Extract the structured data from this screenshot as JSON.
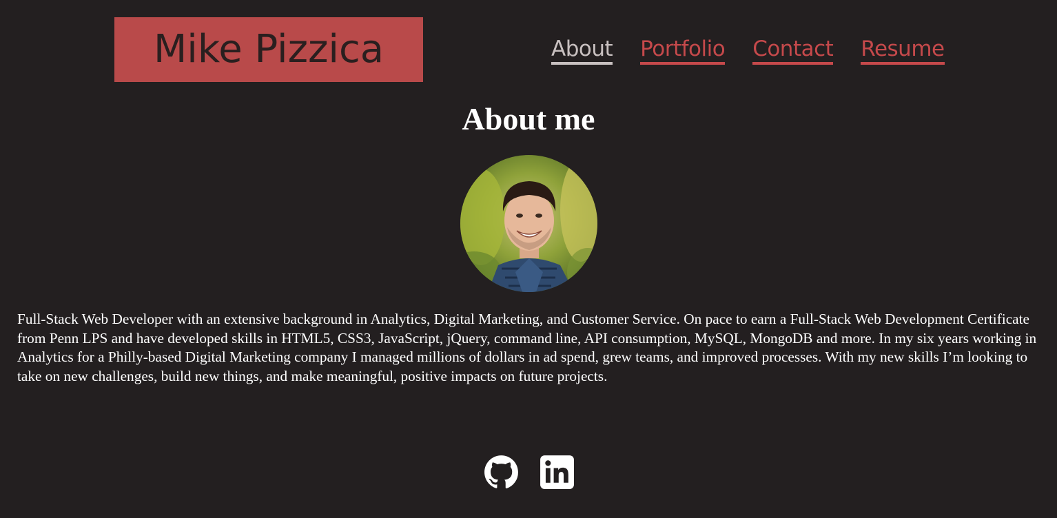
{
  "header": {
    "brand_name": "Mike Pizzica",
    "nav": [
      {
        "label": "About",
        "active": true
      },
      {
        "label": "Portfolio",
        "active": false
      },
      {
        "label": "Contact",
        "active": false
      },
      {
        "label": "Resume",
        "active": false
      }
    ]
  },
  "main": {
    "title": "About me",
    "bio": "Full-Stack Web Developer with an extensive background in Analytics, Digital Marketing, and Customer Service. On pace to earn a Full-Stack Web Development Certificate from Penn LPS and have developed skills in HTML5, CSS3, JavaScript, jQuery, command line, API consumption, MySQL, MongoDB and more. In my six years working in Analytics for a Philly-based Digital Marketing company I managed millions of dollars in ad spend, grew teams, and improved processes. With my new skills I’m looking to take on new challenges, build new things, and make meaningful, positive impacts on future projects."
  },
  "footer": {
    "social": [
      {
        "icon": "github-icon"
      },
      {
        "icon": "linkedin-icon"
      }
    ]
  },
  "colors": {
    "background": "#231f20",
    "accent": "#b94a4a",
    "nav_link": "#c5494b",
    "nav_active": "#c8c0c0",
    "text": "#ffffff"
  }
}
